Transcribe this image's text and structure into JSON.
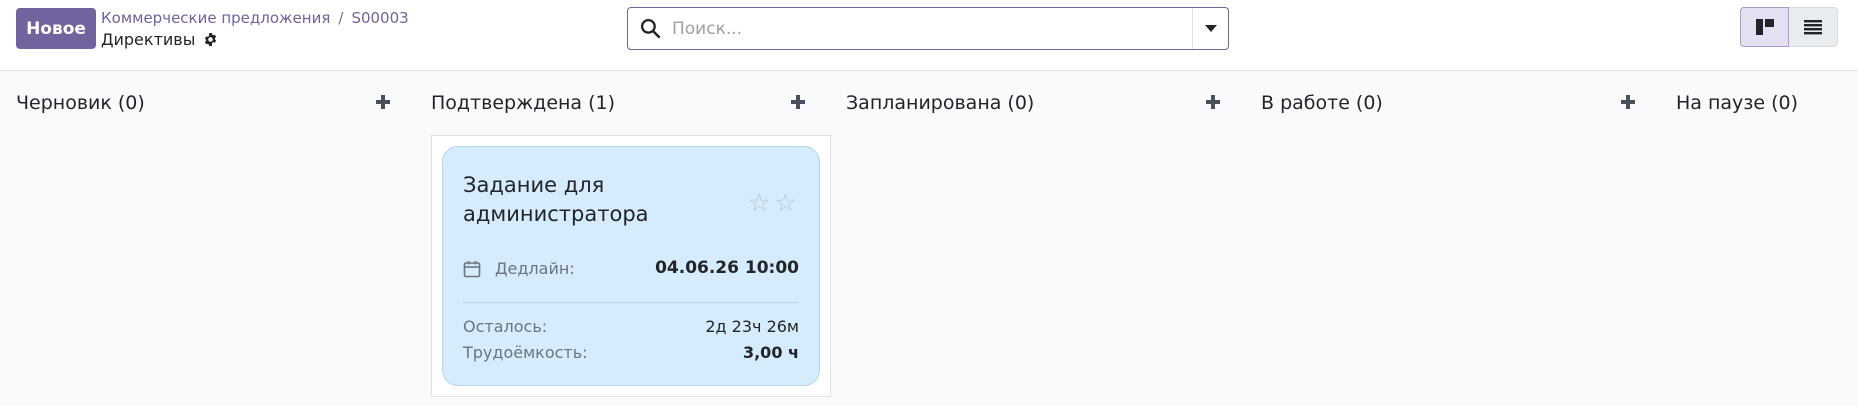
{
  "toolbar": {
    "new_label": "Новое"
  },
  "breadcrumb": {
    "parent": "Коммерческие предложения",
    "separator": "/",
    "current": "S00003",
    "subtitle": "Директивы"
  },
  "search": {
    "placeholder": "Поиск..."
  },
  "columns": [
    {
      "title": "Черновик (0)"
    },
    {
      "title": "Подтверждена (1)"
    },
    {
      "title": "Запланирована (0)"
    },
    {
      "title": "В работе (0)"
    },
    {
      "title": "На паузе (0)"
    }
  ],
  "card": {
    "title": "Задание для администратора",
    "stars": 0,
    "deadline_label": "Дедлайн:",
    "deadline_value": "04.06.26 10:00",
    "remaining_label": "Осталось:",
    "remaining_value": "2д 23ч 26м",
    "effort_label": "Трудоёмкость:",
    "effort_value": "3,00 ч"
  },
  "colors": {
    "primary": "#71639e",
    "card_bg": "#d6ebfb"
  },
  "icons": {
    "search": "search-icon",
    "gear": "gear-icon",
    "calendar": "calendar-icon",
    "kanban": "kanban-icon",
    "list": "list-icon",
    "star": "star-icon"
  }
}
